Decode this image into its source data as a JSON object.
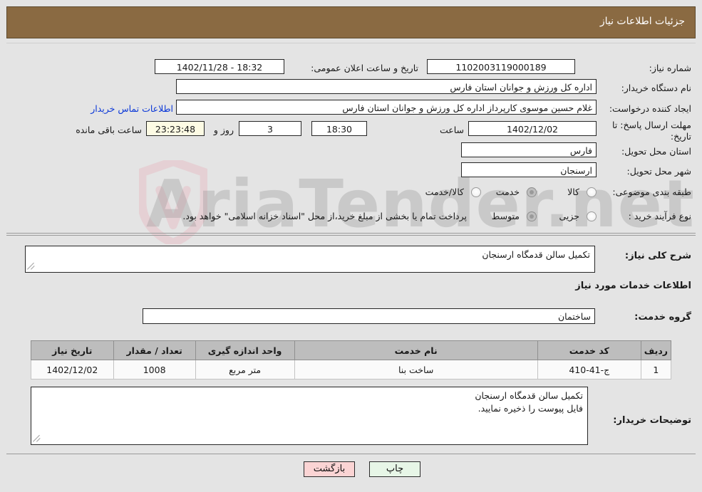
{
  "header": {
    "title": "جزئیات اطلاعات نیاز",
    "bg": "#8a6a42",
    "text_color": "#ffffff"
  },
  "watermark": {
    "text": "AriaTender.net",
    "shield_color": "#e8aab4"
  },
  "info": {
    "need_number_label": "شماره نیاز:",
    "need_number_value": "1102003119000189",
    "announce_label": "تاریخ و ساعت اعلان عمومی:",
    "announce_value": "1402/11/28 - 18:32",
    "buyer_org_label": "نام دستگاه خریدار:",
    "buyer_org_value": "اداره کل ورزش و جوانان استان فارس",
    "creator_label": "ایجاد کننده درخواست:",
    "creator_value": "غلام حسین موسوی کارپرداز اداره کل ورزش و جوانان استان فارس",
    "contact_link": "اطلاعات تماس خریدار",
    "deadline_label": "مهلت ارسال پاسخ: تا تاریخ:",
    "deadline_date": "1402/12/02",
    "deadline_time_label": "ساعت",
    "deadline_time": "18:30",
    "remaining_days": "3",
    "remaining_days_suffix": "روز و",
    "remaining_clock": "23:23:48",
    "remaining_clock_suffix": "ساعت باقی مانده",
    "province_label": "استان محل تحویل:",
    "province_value": "فارس",
    "city_label": "شهر محل تحویل:",
    "city_value": "ارسنجان",
    "category_label": "طبقه بندی موضوعی:",
    "category_options": [
      {
        "label": "کالا",
        "selected": false
      },
      {
        "label": "خدمت",
        "selected": true
      },
      {
        "label": "کالا/خدمت",
        "selected": false
      }
    ],
    "purchase_type_label": "نوع فرآیند خرید :",
    "purchase_type_options": [
      {
        "label": "جزیی",
        "selected": false
      },
      {
        "label": "متوسط",
        "selected": true
      }
    ],
    "payment_note": "پرداخت تمام یا بخشی از مبلغ خرید،از محل \"اسناد خزانه اسلامی\" خواهد بود."
  },
  "description": {
    "label": "شرح کلی نیاز:",
    "value": "تکمیل سالن قدمگاه ارسنجان"
  },
  "services_section": {
    "heading": "اطلاعات خدمات مورد نیاز",
    "group_label": "گروه خدمت:",
    "group_value": "ساختمان"
  },
  "table": {
    "headers": [
      "ردیف",
      "کد خدمت",
      "نام خدمت",
      "واحد اندازه گیری",
      "تعداد / مقدار",
      "تاریخ نیاز"
    ],
    "rows": [
      {
        "row": "1",
        "code": "ج-41-410",
        "name": "ساخت بنا",
        "unit": "متر مربع",
        "quantity": "1008",
        "need_date": "1402/12/02"
      }
    ]
  },
  "buyer_notes": {
    "label": "توضیحات خریدار:",
    "line1": "تکمیل سالن قدمگاه ارسنجان",
    "line2": "فایل پیوست را ذخیره نمایید."
  },
  "buttons": {
    "print": "چاپ",
    "back": "بازگشت"
  }
}
